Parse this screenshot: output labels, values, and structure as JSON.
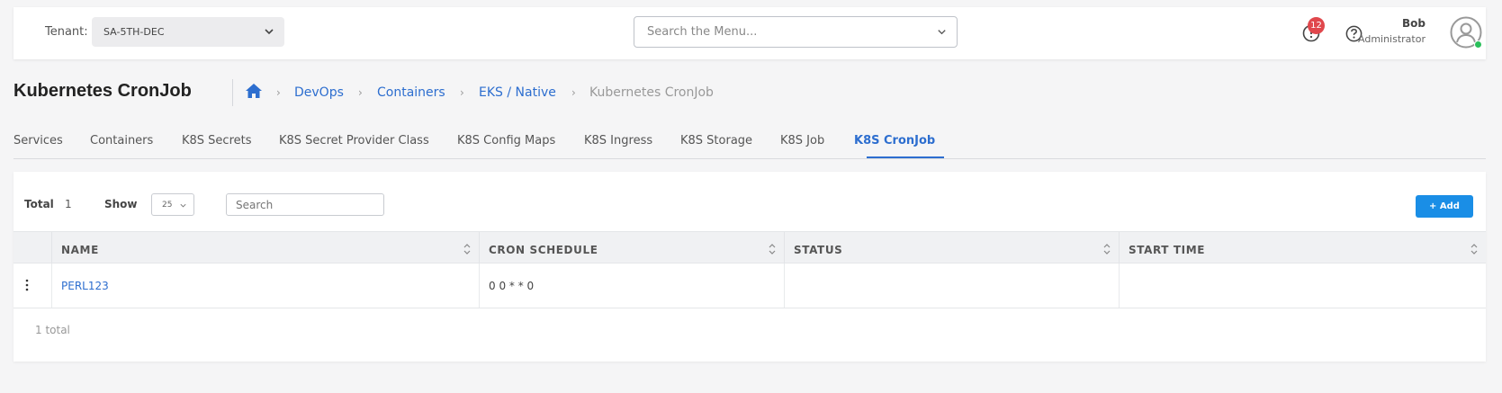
{
  "header": {
    "tenant_label": "Tenant:",
    "tenant_value": "SA-5TH-DEC",
    "menu_search_placeholder": "Search the Menu...",
    "notification_count": "12",
    "user_name": "Bob",
    "user_role": "Administrator"
  },
  "page": {
    "title": "Kubernetes CronJob",
    "breadcrumbs": [
      "DevOps",
      "Containers",
      "EKS / Native",
      "Kubernetes CronJob"
    ],
    "breadcrumb_separator": "›"
  },
  "tabs": [
    {
      "label": "Services"
    },
    {
      "label": "Containers"
    },
    {
      "label": "K8S Secrets"
    },
    {
      "label": "K8S Secret Provider Class"
    },
    {
      "label": "K8S Config Maps"
    },
    {
      "label": "K8S Ingress"
    },
    {
      "label": "K8S Storage"
    },
    {
      "label": "K8S Job"
    },
    {
      "label": "K8S CronJob",
      "active": true
    }
  ],
  "toolbar": {
    "total_label": "Total",
    "total_value": "1",
    "show_label": "Show",
    "show_value": "25",
    "search_placeholder": "Search",
    "add_label": "+ Add"
  },
  "table": {
    "columns": [
      "NAME",
      "CRON SCHEDULE",
      "STATUS",
      "START TIME"
    ],
    "rows": [
      {
        "name": "PERL123",
        "cron_schedule": "0 0 * * 0",
        "status": "",
        "start_time": ""
      }
    ],
    "footer": "1 total"
  },
  "colors": {
    "accent": "#2d6ecf",
    "add_button": "#1a8ee6",
    "badge": "#e0474c",
    "online": "#2bbf5b"
  }
}
